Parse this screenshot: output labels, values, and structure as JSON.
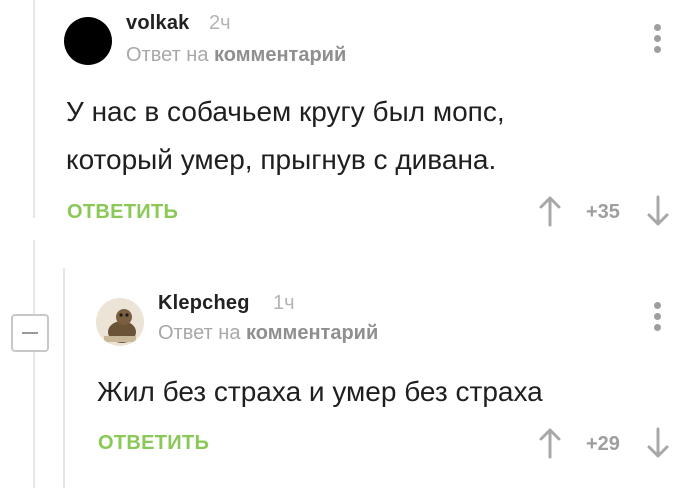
{
  "thread": {
    "collapse_label": "−"
  },
  "comments": [
    {
      "username": "volkak",
      "time": "2ч",
      "reply_to_prefix": "Ответ на",
      "reply_to_target": "комментарий",
      "text_lines": [
        "У нас в собачьем кругу был мопс,",
        "который умер, прыгнув с дивана."
      ],
      "reply_label": "ОТВЕТИТЬ",
      "score": "+35",
      "avatar": "black-circle"
    },
    {
      "username": "Klepcheg",
      "time": "1ч",
      "reply_to_prefix": "Ответ на",
      "reply_to_target": "комментарий",
      "text_lines": [
        "Жил без страха и умер без страха"
      ],
      "reply_label": "ОТВЕТИТЬ",
      "score": "+29",
      "avatar": "animal-photo"
    }
  ],
  "icons": {
    "more": "vertical-dots-icon",
    "upvote": "arrow-up-icon",
    "downvote": "arrow-down-icon",
    "collapse": "minus-square-icon"
  },
  "colors": {
    "accent": "#8ac858",
    "muted": "#9e9e9e",
    "text": "#1f1f1f"
  }
}
